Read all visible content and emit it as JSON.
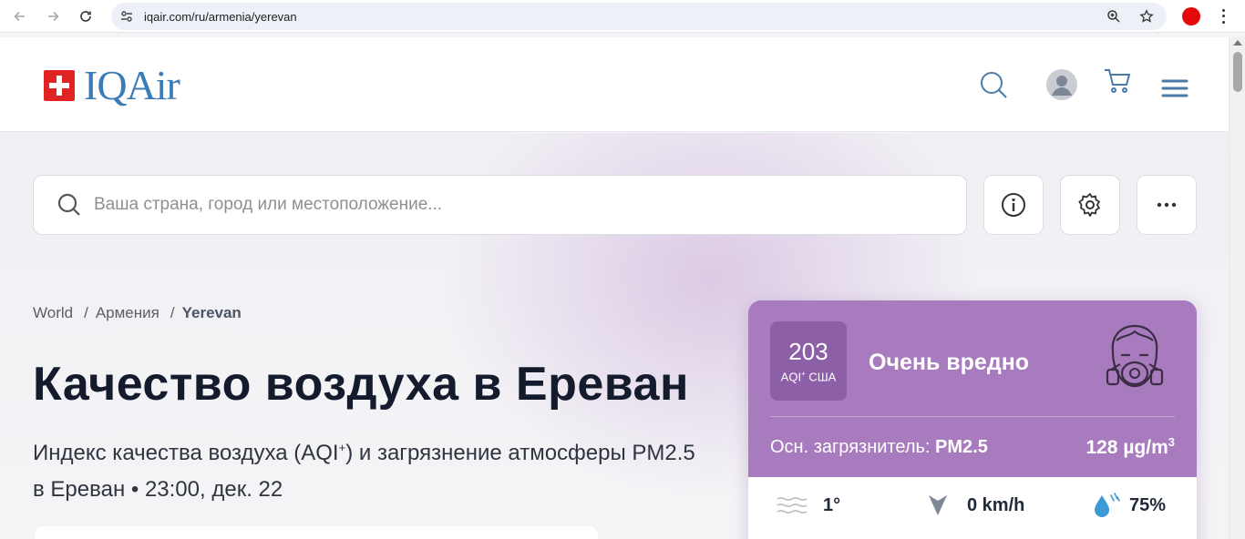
{
  "browser": {
    "url": "iqair.com/ru/armenia/yerevan"
  },
  "header": {
    "logo_text": "IQAir"
  },
  "search": {
    "placeholder": "Ваша страна, город или местоположение..."
  },
  "breadcrumb": {
    "items": [
      "World",
      "Армения",
      "Yerevan"
    ],
    "separator": "/"
  },
  "page": {
    "title": "Качество воздуха в Ереван",
    "subtitle_pre": "Индекс качества воздуха (AQI",
    "subtitle_sup": "+",
    "subtitle_post": ") и загрязнение атмосферы PM2.5 в Ереван • 23:00, дек. 22"
  },
  "aqi_card": {
    "aqi_value": "203",
    "aqi_unit": "AQI",
    "aqi_unit_sup": "+",
    "aqi_unit_post": " США",
    "status": "Очень вредно",
    "main_pollutant_label": "Осн. загрязнитель: ",
    "main_pollutant": "PM2.5",
    "pollutant_value": "128  µg/m",
    "pollutant_unit_sup": "3",
    "background_color": "#a77bbd",
    "badge_color": "#8c5fa6",
    "weather": {
      "temperature": "1°",
      "wind": "0 km/h",
      "humidity": "75%"
    }
  },
  "icons": {
    "back": "arrow-left-icon",
    "forward": "arrow-right-icon",
    "reload": "reload-icon",
    "site_settings": "tune-icon",
    "zoom": "zoom-icon",
    "bookmark": "star-icon",
    "search": "search-icon",
    "user": "user-avatar-icon",
    "cart": "cart-icon",
    "menu": "hamburger-menu-icon",
    "info": "info-icon",
    "settings": "gear-icon",
    "more": "more-dots-icon",
    "mask": "gas-mask-face-icon",
    "wind": "wind-icon",
    "wind_direction": "wind-direction-icon",
    "humidity": "water-drop-icon"
  }
}
